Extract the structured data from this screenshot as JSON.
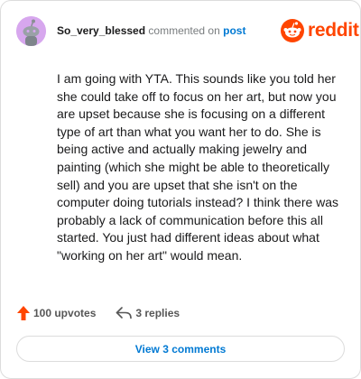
{
  "comment": {
    "username": "So_very_blessed",
    "action_text": "commented on",
    "post_link": "post",
    "body": "I am going with YTA. This sounds like you told her she could take off to focus on her art, but now you are upset because she is focusing on a different type of art than what you want her to do. She is being active and actually making jewelry and painting (which she might be able to theoretically sell) and you are upset that she isn't on the computer doing tutorials instead? I think there was probably a lack of communication before this all started. You just had different ideas about what \"working on her art\" would mean."
  },
  "brand": {
    "name": "reddit",
    "color": "#ff4500"
  },
  "actions": {
    "upvotes_label": "100 upvotes",
    "replies_label": "3 replies"
  },
  "footer": {
    "view_comments_label": "View 3 comments"
  },
  "icons": {
    "avatar": "snoo-avatar-icon",
    "upvote": "upvote-arrow-icon",
    "reply": "reply-arrow-icon",
    "logo": "reddit-snoo-logo-icon"
  },
  "colors": {
    "link": "#0079d3",
    "avatar_bg": "#d7a7ee",
    "upvote": "#ff4500"
  }
}
